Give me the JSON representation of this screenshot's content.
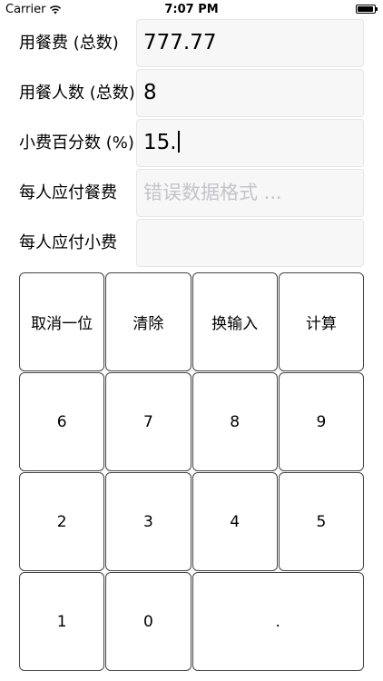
{
  "status_bar": {
    "carrier": "Carrier",
    "time": "7:07 PM"
  },
  "form": {
    "rows": [
      {
        "label": "用餐费 (总数)",
        "value": "777.77",
        "placeholder": ""
      },
      {
        "label": "用餐人数 (总数)",
        "value": "8",
        "placeholder": ""
      },
      {
        "label": "小费百分数 (%)",
        "value": "15.",
        "placeholder": ""
      },
      {
        "label": "每人应付餐费",
        "value": "",
        "placeholder": "错误数据格式 ..."
      },
      {
        "label": "每人应付小费",
        "value": "",
        "placeholder": ""
      }
    ]
  },
  "keypad": {
    "keys": [
      "取消一位",
      "清除",
      "换输入",
      "计算",
      "6",
      "7",
      "8",
      "9",
      "2",
      "3",
      "4",
      "5",
      "1",
      "0",
      "."
    ]
  }
}
